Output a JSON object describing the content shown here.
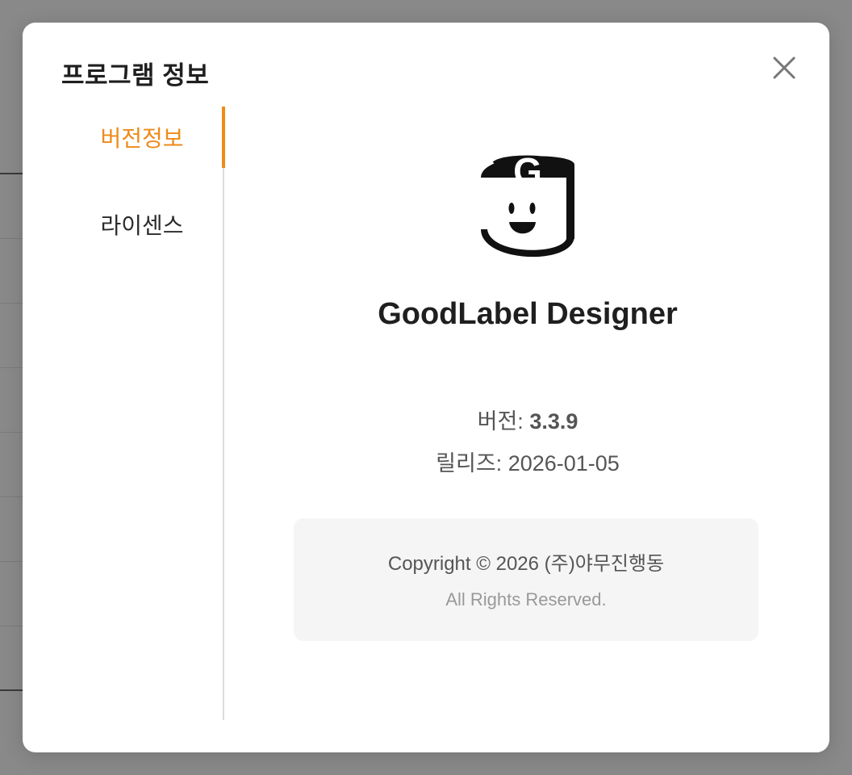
{
  "dialog": {
    "title": "프로그램 정보"
  },
  "sidebar": {
    "items": [
      {
        "label": "버전정보",
        "active": true
      },
      {
        "label": "라이센스",
        "active": false
      }
    ]
  },
  "about": {
    "app_name": "GoodLabel Designer",
    "version_label": "버전:",
    "version_value": "3.3.9",
    "release_label": "릴리즈:",
    "release_value": "2026-01-05",
    "copyright": "Copyright © 2026 (주)야무진행동",
    "rights": "All Rights Reserved."
  },
  "icons": {
    "close": "close-icon",
    "logo": "goodlabel-logo"
  },
  "colors": {
    "accent": "#ef8a1a",
    "backdrop": "#898989",
    "text": "#1f1f1f"
  }
}
